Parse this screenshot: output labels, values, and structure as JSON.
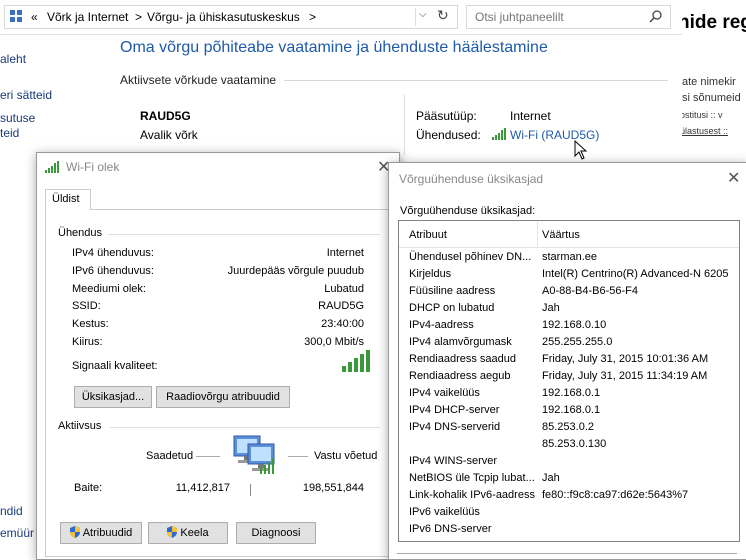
{
  "control_panel": {
    "breadcrumb": [
      "«",
      "Võrk ja Internet",
      ">",
      "Võrgu- ja ühiskasutuskeskus",
      ">"
    ],
    "search_placeholder": "Otsi juhtpaneelilt",
    "title": "Oma võrgu põhiteabe vaatamine ja ühenduste häälestamine",
    "active_networks_label": "Aktiivsete võrkude vaatamine",
    "network_name": "RAUD5G",
    "network_type": "Avalik võrk",
    "access_type_label": "Pääsutüüp:",
    "access_type_value": "Internet",
    "connections_label": "Ühendused:",
    "connection_link": "Wi-Fi (RAUD5G)",
    "left_links": [
      "aleht",
      "eri sätteid",
      "sutuse",
      "teid",
      "ndid",
      "emüür"
    ]
  },
  "right_window": {
    "heading_fragment": "nide reg",
    "lines": [
      "ate nimekir",
      "si sõnumeid",
      "ostitusi :: v",
      "ülastusest :: "
    ]
  },
  "wifi_status": {
    "title": "Wi-Fi olek",
    "tab": "Üldist",
    "connection_group": "Ühendus",
    "rows": [
      {
        "label": "IPv4 ühenduvus:",
        "value": "Internet"
      },
      {
        "label": "IPv6 ühenduvus:",
        "value": "Juurdepääs võrgule puudub"
      },
      {
        "label": "Meediumi olek:",
        "value": "Lubatud"
      },
      {
        "label": "SSID:",
        "value": "RAUD5G"
      },
      {
        "label": "Kestus:",
        "value": "23:40:00"
      },
      {
        "label": "Kiirus:",
        "value": "300,0 Mbit/s"
      }
    ],
    "signal_label": "Signaali kvaliteet:",
    "signal_level": 1.0,
    "details_button": "Üksikasjad...",
    "radio_button": "Raadiovõrgu atribuudid",
    "activity_group": "Aktiivsus",
    "sent_label": "Saadetud",
    "received_label": "Vastu võetud",
    "bytes_label": "Baite:",
    "bytes_sent": "11,412,817",
    "bytes_received": "198,551,844",
    "properties_button": "Atribuudid",
    "disable_button": "Keela",
    "diagnose_button": "Diagnoosi"
  },
  "details": {
    "title": "Võrguühenduse üksikasjad",
    "subtitle": "Võrguühenduse üksikasjad:",
    "col_property": "Atribuut",
    "col_value": "Väärtus",
    "rows": [
      {
        "prop": "Ühendusel põhinev DN...",
        "value": "starman.ee"
      },
      {
        "prop": "Kirjeldus",
        "value": "Intel(R) Centrino(R) Advanced-N 6205"
      },
      {
        "prop": "Füüsiline aadress",
        "value": "A0-88-B4-B6-56-F4"
      },
      {
        "prop": "DHCP on lubatud",
        "value": "Jah"
      },
      {
        "prop": "IPv4-aadress",
        "value": "192.168.0.10"
      },
      {
        "prop": "IPv4 alamvõrgumask",
        "value": "255.255.255.0"
      },
      {
        "prop": "Rendiaadress saadud",
        "value": "Friday, July 31, 2015 10:01:36 AM"
      },
      {
        "prop": "Rendiaadress aegub",
        "value": "Friday, July 31, 2015 11:34:19 AM"
      },
      {
        "prop": "IPv4 vaikelüüs",
        "value": "192.168.0.1"
      },
      {
        "prop": "IPv4 DHCP-server",
        "value": "192.168.0.1"
      },
      {
        "prop": "IPv4 DNS-serverid",
        "value": "85.253.0.2"
      },
      {
        "prop": "",
        "value": "85.253.0.130"
      },
      {
        "prop": "IPv4 WINS-server",
        "value": ""
      },
      {
        "prop": "NetBIOS üle Tcpip lubat...",
        "value": "Jah"
      },
      {
        "prop": "Link-kohalik IPv6-aadress",
        "value": "fe80::f9c8:ca97:d62e:5643%7"
      },
      {
        "prop": "IPv6 vaikelüüs",
        "value": ""
      },
      {
        "prop": "IPv6 DNS-server",
        "value": ""
      }
    ]
  },
  "colors": {
    "link": "#1e5aa8",
    "signal_green": "#3a9a3a"
  }
}
